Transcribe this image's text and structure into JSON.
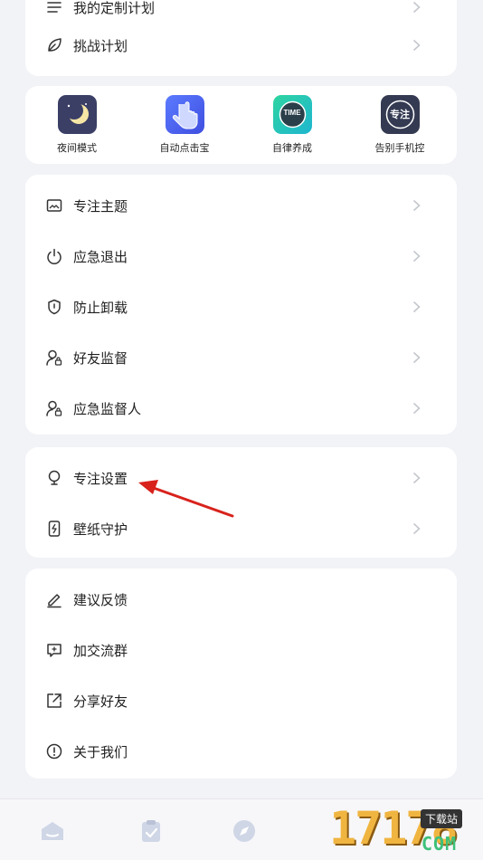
{
  "top_card": {
    "partial_label": "我的定制计划",
    "challenge_label": "挑战计划"
  },
  "shortcuts": [
    {
      "label": "夜间模式",
      "icon": "moon-icon",
      "color": "#3b3f66"
    },
    {
      "label": "自动点击宝",
      "icon": "tap-hand-icon",
      "color": "#3f63f2"
    },
    {
      "label": "自律养成",
      "icon": "time-icon",
      "color": "#24c9b5",
      "badge": "TIME"
    },
    {
      "label": "告别手机控",
      "icon": "focus-badge-icon",
      "color": "#343a52",
      "badge": "专注"
    }
  ],
  "focus_card": {
    "items": [
      {
        "label": "专注主题",
        "icon": "image-icon"
      },
      {
        "label": "应急退出",
        "icon": "power-icon"
      },
      {
        "label": "防止卸载",
        "icon": "shield-icon"
      },
      {
        "label": "好友监督",
        "icon": "user-lock-icon"
      },
      {
        "label": "应急监督人",
        "icon": "user-lock-icon"
      }
    ]
  },
  "settings_card": {
    "items": [
      {
        "label": "专注设置",
        "icon": "bulb-icon"
      },
      {
        "label": "壁纸守护",
        "icon": "phone-bolt-icon"
      }
    ]
  },
  "misc_card": {
    "items": [
      {
        "label": "建议反馈",
        "icon": "edit-icon"
      },
      {
        "label": "加交流群",
        "icon": "chat-icon"
      },
      {
        "label": "分享好友",
        "icon": "share-icon"
      },
      {
        "label": "关于我们",
        "icon": "info-icon"
      }
    ]
  },
  "watermark": {
    "site": "17178",
    "tag": "下载站",
    "suffix": "COM"
  },
  "colors": {
    "accent": "#3f63f2",
    "arrow": "#d8221c",
    "muted": "#8a8f99",
    "chevron": "#c4c7cc"
  }
}
